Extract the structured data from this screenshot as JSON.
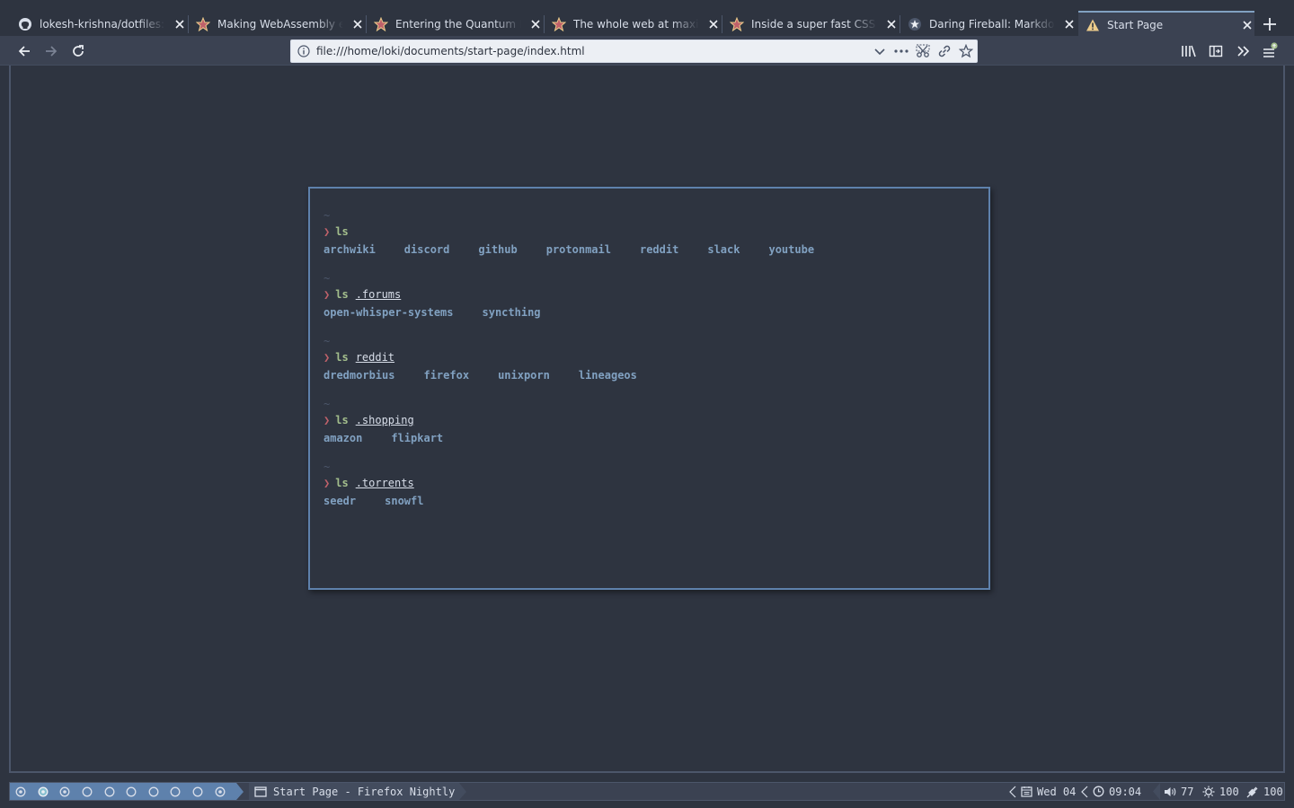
{
  "browser": {
    "tabs": [
      {
        "title": "lokesh-krishna/dotfiles: A collection of dotfiles",
        "icon": "github-icon"
      },
      {
        "title": "Making WebAssembly even faster",
        "icon": "bookmark-star-icon"
      },
      {
        "title": "Entering the Quantum Era",
        "icon": "bookmark-star-icon"
      },
      {
        "title": "The whole web at maximum FPS",
        "icon": "bookmark-star-icon"
      },
      {
        "title": "Inside a super fast CSS engine",
        "icon": "bookmark-star-icon"
      },
      {
        "title": "Daring Fireball: Markdown",
        "icon": "star-icon"
      },
      {
        "title": "Start Page",
        "icon": "warning-icon",
        "active": true
      }
    ],
    "url": "file:///home/loki/documents/start-page/index.html"
  },
  "terminal": {
    "tilde": "~",
    "prompt_symbol": "❯",
    "command": "ls",
    "sections": [
      {
        "dir": "",
        "links": [
          "archwiki",
          "discord",
          "github",
          "protonmail",
          "reddit",
          "slack",
          "youtube"
        ]
      },
      {
        "dir": ".forums",
        "links": [
          "open-whisper-systems",
          "syncthing"
        ]
      },
      {
        "dir": "reddit",
        "links": [
          "dredmorbius",
          "firefox",
          "unixporn",
          "lineageos"
        ]
      },
      {
        "dir": ".shopping",
        "links": [
          "amazon",
          "flipkart"
        ]
      },
      {
        "dir": ".torrents",
        "links": [
          "seedr",
          "snowfl"
        ]
      }
    ]
  },
  "statusbar": {
    "window_title": "Start Page - Firefox Nightly",
    "date": "Wed 04",
    "time": "09:04",
    "volume": "77",
    "brightness": "100",
    "battery": "100"
  },
  "colors": {
    "background": "#2e3440",
    "accent": "#5e81ac",
    "link": "#81a1c1",
    "prompt_arrow": "#bf616a",
    "command": "#a3be8c"
  }
}
